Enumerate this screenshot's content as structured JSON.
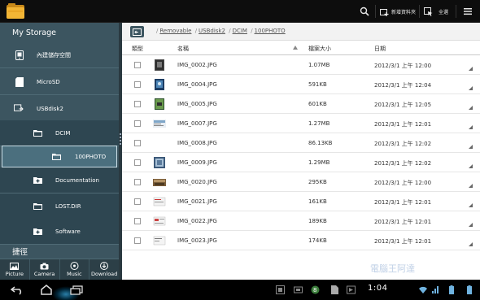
{
  "topbar": {
    "new_folder_label": "新增資料夾",
    "select_all_label": "全選"
  },
  "sidebar": {
    "title": "My Storage",
    "items": [
      {
        "label": "內建儲存空間",
        "icon": "internal-storage-icon"
      },
      {
        "label": "MicroSD",
        "icon": "sd-card-icon"
      },
      {
        "label": "USBdisk2",
        "icon": "usb-drive-icon"
      },
      {
        "label": "DCIM",
        "icon": "folder-icon"
      },
      {
        "label": "100PHOTO",
        "icon": "folder-icon"
      },
      {
        "label": "Documentation",
        "icon": "folder-icon"
      },
      {
        "label": "LOST.DIR",
        "icon": "folder-icon"
      },
      {
        "label": "Software",
        "icon": "folder-icon"
      }
    ],
    "shortcut_title": "捷徑",
    "quick": [
      {
        "label": "Picture",
        "icon": "picture-icon"
      },
      {
        "label": "Camera",
        "icon": "camera-icon"
      },
      {
        "label": "Music",
        "icon": "music-icon"
      },
      {
        "label": "Download",
        "icon": "download-icon"
      }
    ]
  },
  "breadcrumb": {
    "sep": "/",
    "parts": [
      "Removable",
      "USBdisk2",
      "DCIM",
      "100PHOTO"
    ]
  },
  "columns": {
    "type": "類型",
    "name": "名稱",
    "size": "檔案大小",
    "date": "日期"
  },
  "files": [
    {
      "name": "IMG_0002.JPG",
      "size": "1.07MB",
      "date": "2012/3/1 上午 12:00"
    },
    {
      "name": "IMG_0004.JPG",
      "size": "591KB",
      "date": "2012/3/1 上午 12:04"
    },
    {
      "name": "IMG_0005.JPG",
      "size": "601KB",
      "date": "2012/3/1 上午 12:05"
    },
    {
      "name": "IMG_0007.JPG",
      "size": "1.27MB",
      "date": "2012/3/1 上午 12:01"
    },
    {
      "name": "IMG_0008.JPG",
      "size": "86.13KB",
      "date": "2012/3/1 上午 12:02"
    },
    {
      "name": "IMG_0009.JPG",
      "size": "1.29MB",
      "date": "2012/3/1 上午 12:02"
    },
    {
      "name": "IMG_0020.JPG",
      "size": "295KB",
      "date": "2012/3/1 上午 12:00"
    },
    {
      "name": "IMG_0021.JPG",
      "size": "161KB",
      "date": "2012/3/1 上午 12:01"
    },
    {
      "name": "IMG_0022.JPG",
      "size": "189KB",
      "date": "2012/3/1 上午 12:01"
    },
    {
      "name": "IMG_0023.JPG",
      "size": "174KB",
      "date": "2012/3/1 上午 12:01"
    }
  ],
  "status": {
    "clock": "1:04"
  },
  "watermark": "電腦王阿達",
  "colors": {
    "sidebar": "#3c5560",
    "accent": "#2a7fa8"
  }
}
